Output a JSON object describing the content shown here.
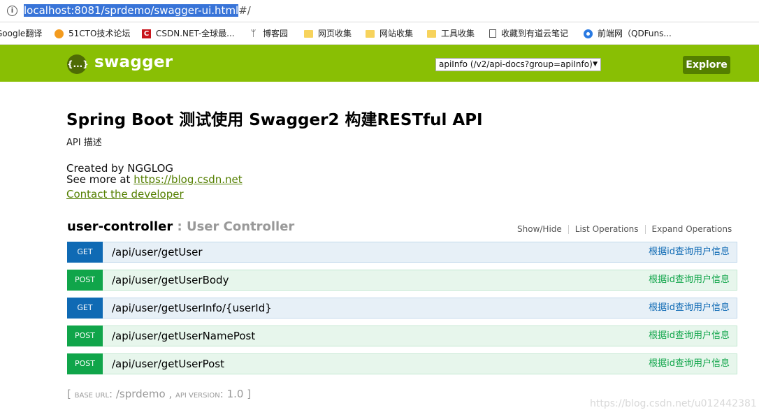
{
  "browser": {
    "url_selected": "localhost:8081/sprdemo/swagger-ui.html",
    "url_rest": "#/",
    "bookmarks": [
      {
        "label": "Google翻译",
        "icon": "none"
      },
      {
        "label": "51CTO技术论坛",
        "icon": "cto-icon"
      },
      {
        "label": "CSDN.NET-全球最...",
        "icon": "csdn-icon"
      },
      {
        "label": "博客园",
        "icon": "blog-icon"
      },
      {
        "label": "网页收集",
        "icon": "folder-icon"
      },
      {
        "label": "网站收集",
        "icon": "folder-icon"
      },
      {
        "label": "工具收集",
        "icon": "folder-icon"
      },
      {
        "label": "收藏到有道云笔记",
        "icon": "doc-icon"
      },
      {
        "label": "前端网（QDFuns...",
        "icon": "qd-icon"
      }
    ]
  },
  "header": {
    "logo_mark": "{...}",
    "logo_text": "swagger",
    "api_select": "apiInfo (/v2/api-docs?group=apiInfo)",
    "explore_label": "Explore",
    "color": "#89bf04"
  },
  "info": {
    "title": "Spring Boot 测试使用 Swagger2 构建RESTful API",
    "description": "API 描述",
    "created_by": "Created by NGGLOG",
    "see_more_prefix": "See more at ",
    "see_more_link": "https://blog.csdn.net",
    "contact": "Contact the developer"
  },
  "resource": {
    "name": "user-controller",
    "separator": " : ",
    "description": "User Controller",
    "links": [
      "Show/Hide",
      "List Operations",
      "Expand Operations"
    ]
  },
  "operations": [
    {
      "method": "GET",
      "path": "/api/user/getUser",
      "summary": "根据id查询用户信息"
    },
    {
      "method": "POST",
      "path": "/api/user/getUserBody",
      "summary": "根据id查询用户信息"
    },
    {
      "method": "GET",
      "path": "/api/user/getUserInfo/{userId}",
      "summary": "根据id查询用户信息"
    },
    {
      "method": "POST",
      "path": "/api/user/getUserNamePost",
      "summary": "根据id查询用户信息"
    },
    {
      "method": "POST",
      "path": "/api/user/getUserPost",
      "summary": "根据id查询用户信息"
    }
  ],
  "footer": {
    "open": "[ ",
    "base_url_label": "Base url",
    "base_url_sep": ": ",
    "base_url": "/sprdemo",
    "comma": " , ",
    "api_version_label": "api version",
    "api_version_sep": ": ",
    "api_version": "1.0",
    "close": " ]"
  },
  "watermark": "https://blog.csdn.net/u012442381"
}
